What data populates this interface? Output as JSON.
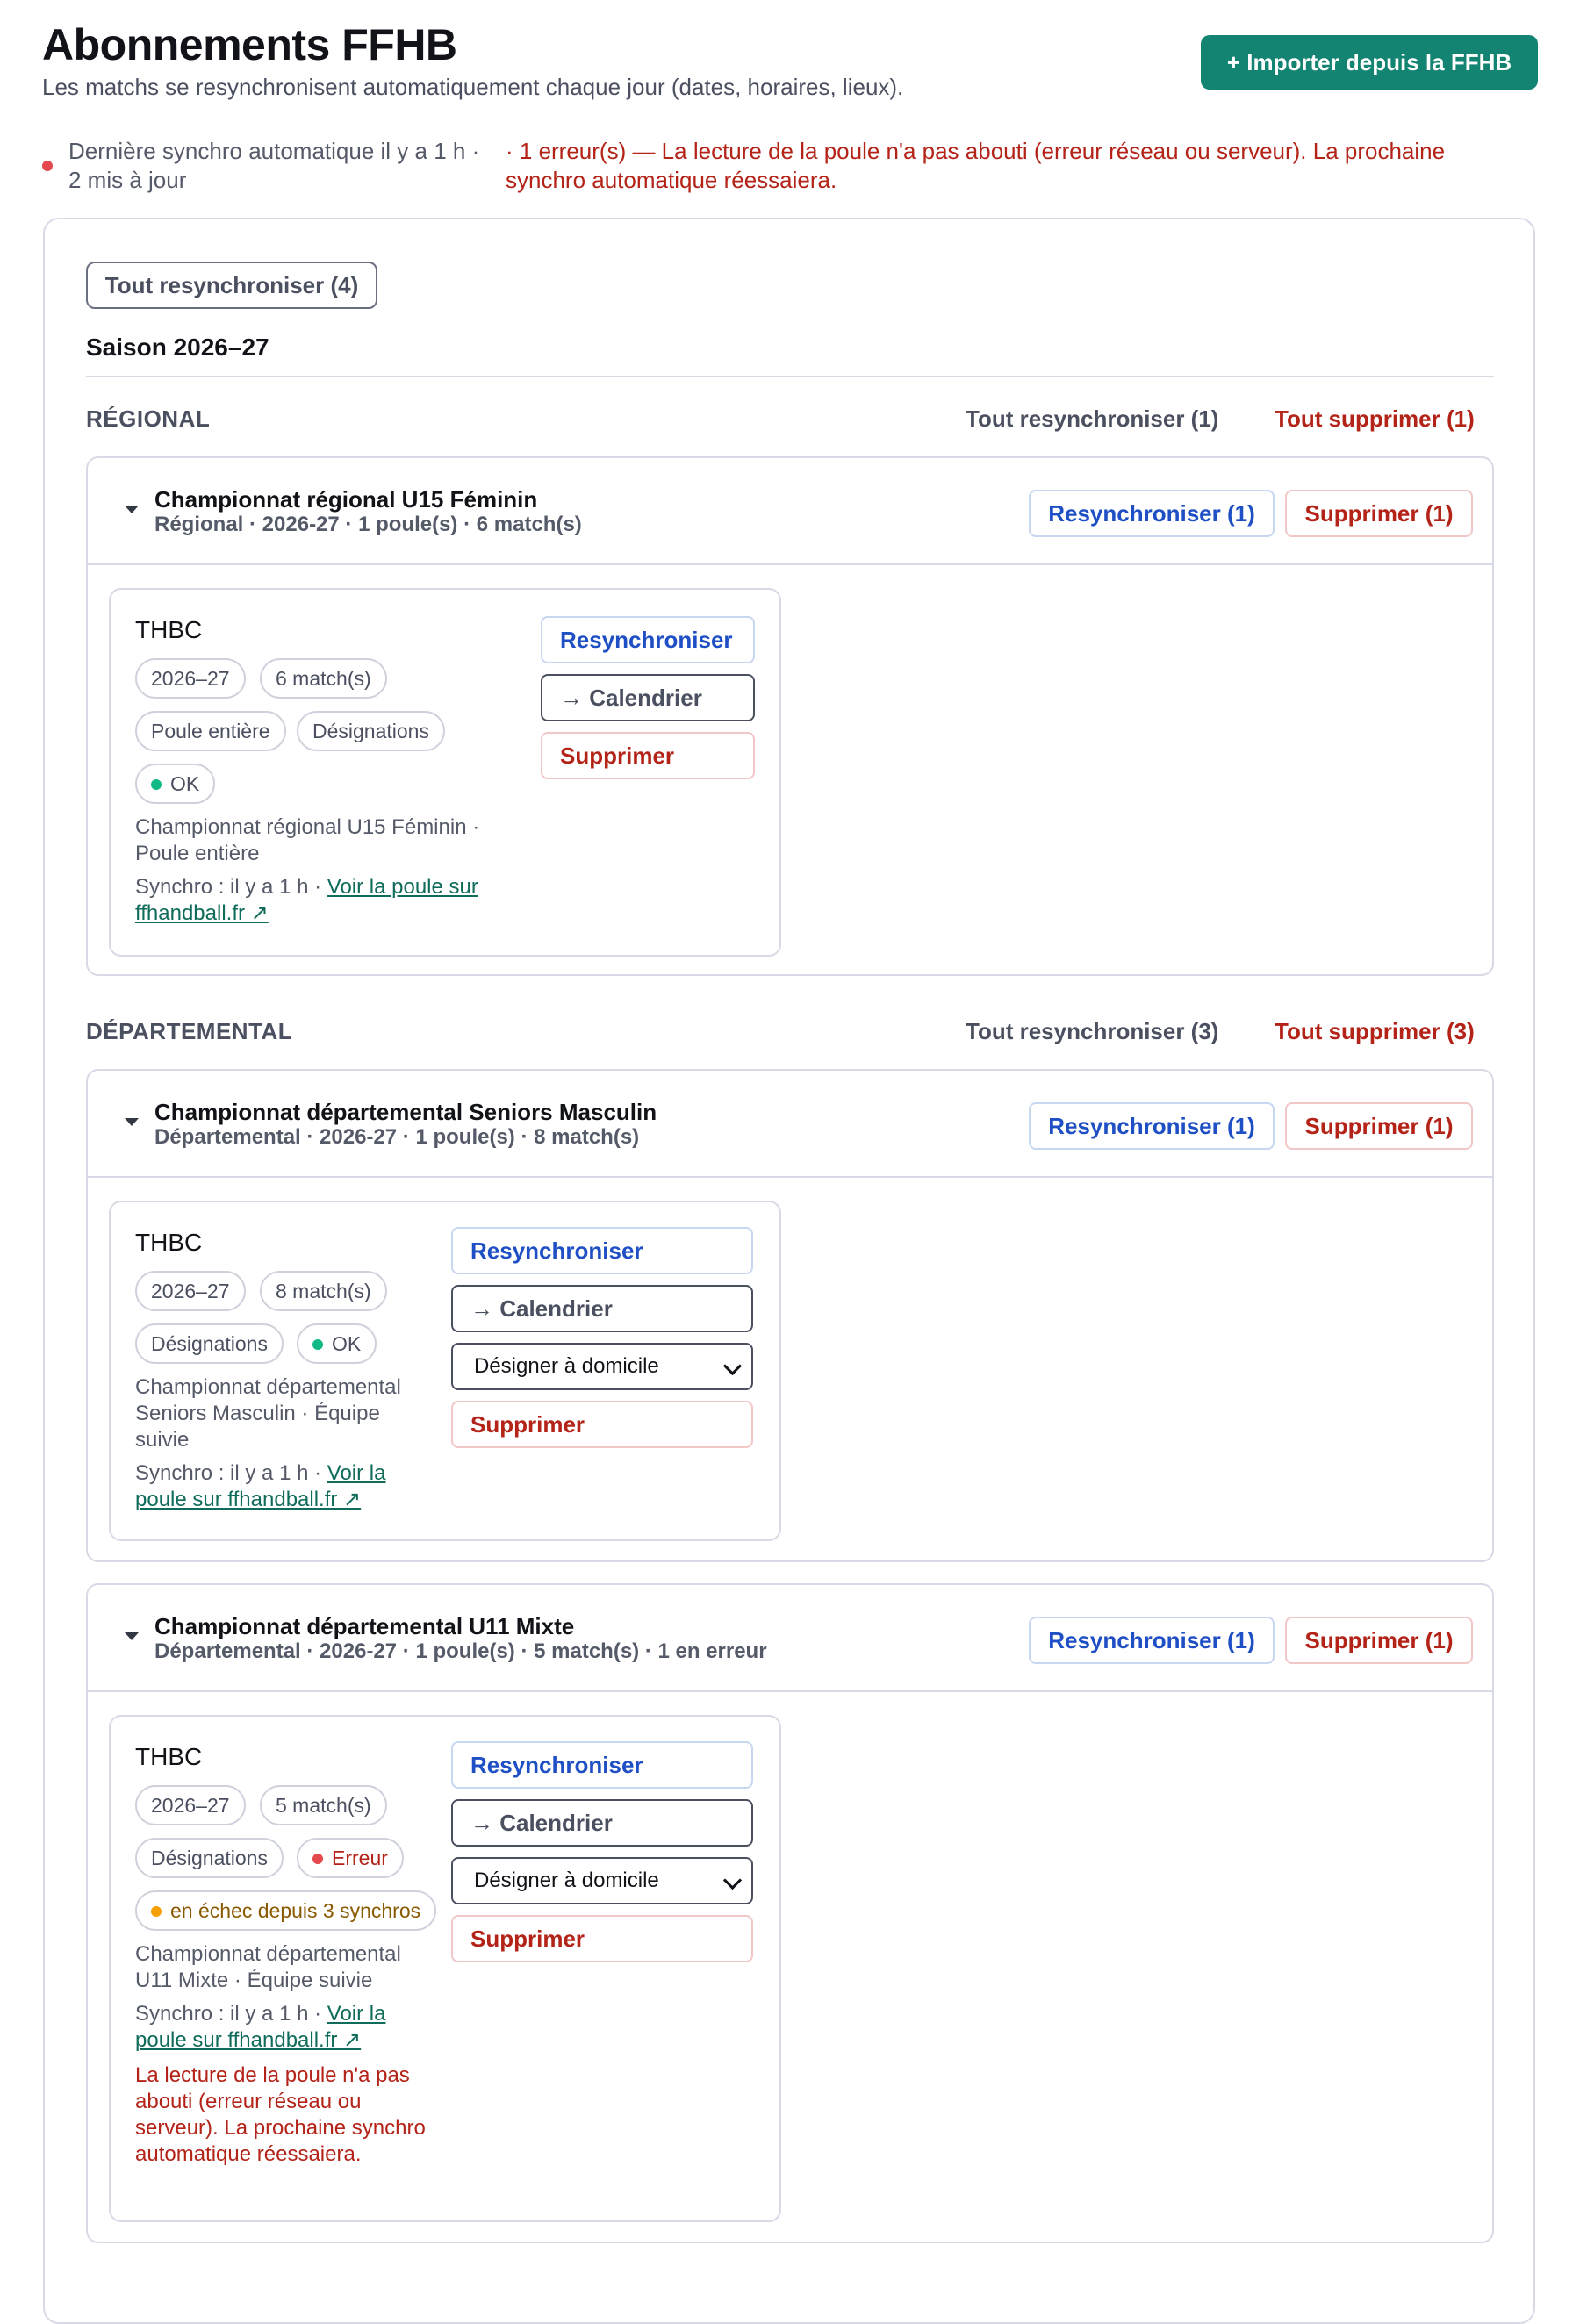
{
  "header": {
    "title": "Abonnements FFHB",
    "subtitle": "Les matchs se resynchronisent automatiquement chaque jour (dates, horaires, lieux).",
    "import_label": "+ Importer depuis la FFHB"
  },
  "status": {
    "line1": "Dernière synchro automatique il y a 1 h ·",
    "line2": "2 mis à jour",
    "error_line1": "· 1 erreur(s) — La lecture de la poule n'a pas abouti (erreur réseau ou serveur). La prochaine",
    "error_line2": "synchro automatique réessaiera.",
    "dot_color": "#e5484d"
  },
  "toolbar": {
    "resync_all_label": "Tout resynchroniser (4)"
  },
  "season": {
    "label": "Saison 2026–27"
  },
  "levels": [
    {
      "label": "RÉGIONAL",
      "resync_all": "Tout resynchroniser (1)",
      "delete_all": "Tout supprimer (1)"
    },
    {
      "label": "DÉPARTEMENTAL",
      "resync_all": "Tout resynchroniser (3)",
      "delete_all": "Tout supprimer (3)"
    }
  ],
  "competitions": [
    {
      "title": "Championnat régional U15 Féminin",
      "meta": "Régional · 2026-27 · 1 poule(s) · 6 match(s)",
      "resync": "Resynchroniser (1)",
      "delete": "Supprimer (1)",
      "card": {
        "team": "THBC",
        "season_chip": "2026–27",
        "matches_chip": "6 match(s)",
        "scope_chip": "Poule entière",
        "designations_chip": "Désignations",
        "status_chip": "OK",
        "desc1": "Championnat régional U15 Féminin ·",
        "desc2": "Poule entière",
        "sync_prefix": "Synchro : il y a 1 h · ",
        "link1": "Voir la poule sur",
        "link2": "ffhandball.fr ↗",
        "resync": "Resynchroniser",
        "calendar": "→ Calendrier",
        "delete": "Supprimer"
      }
    },
    {
      "title": "Championnat départemental Seniors Masculin",
      "meta": "Départemental · 2026-27 · 1 poule(s) · 8 match(s)",
      "resync": "Resynchroniser (1)",
      "delete": "Supprimer (1)",
      "card": {
        "team": "THBC",
        "season_chip": "2026–27",
        "matches_chip": "8 match(s)",
        "designations_chip": "Désignations",
        "status_chip": "OK",
        "desc1": "Championnat départemental",
        "desc2": "Seniors Masculin · Équipe",
        "desc3": "suivie",
        "sync_prefix": "Synchro : il y a 1 h · ",
        "link1": "Voir la",
        "link2": "poule sur ffhandball.fr ↗",
        "resync": "Resynchroniser",
        "calendar": "→ Calendrier",
        "designate": "Désigner à domicile",
        "delete": "Supprimer"
      }
    },
    {
      "title": "Championnat départemental U11 Mixte",
      "meta": "Départemental · 2026-27 · 1 poule(s) · 5 match(s) · 1 en erreur",
      "resync": "Resynchroniser (1)",
      "delete": "Supprimer (1)",
      "card": {
        "team": "THBC",
        "season_chip": "2026–27",
        "matches_chip": "5 match(s)",
        "designations_chip": "Désignations",
        "status_chip": "Erreur",
        "failure_chip": "en échec depuis 3 synchros",
        "desc1": "Championnat départemental",
        "desc2": "U11 Mixte · Équipe suivie",
        "sync_prefix": "Synchro : il y a 1 h · ",
        "link1": "Voir la",
        "link2": "poule sur ffhandball.fr ↗",
        "error_message": "La lecture de la poule n'a pas abouti (erreur réseau ou serveur). La prochaine synchro automatique réessaiera.",
        "resync": "Resynchroniser",
        "calendar": "→ Calendrier",
        "designate": "Désigner à domicile",
        "delete": "Supprimer"
      }
    }
  ],
  "colors": {
    "ok": "#12b886",
    "error": "#e5484d",
    "warning": "#f59f00",
    "accent": "#138471"
  }
}
